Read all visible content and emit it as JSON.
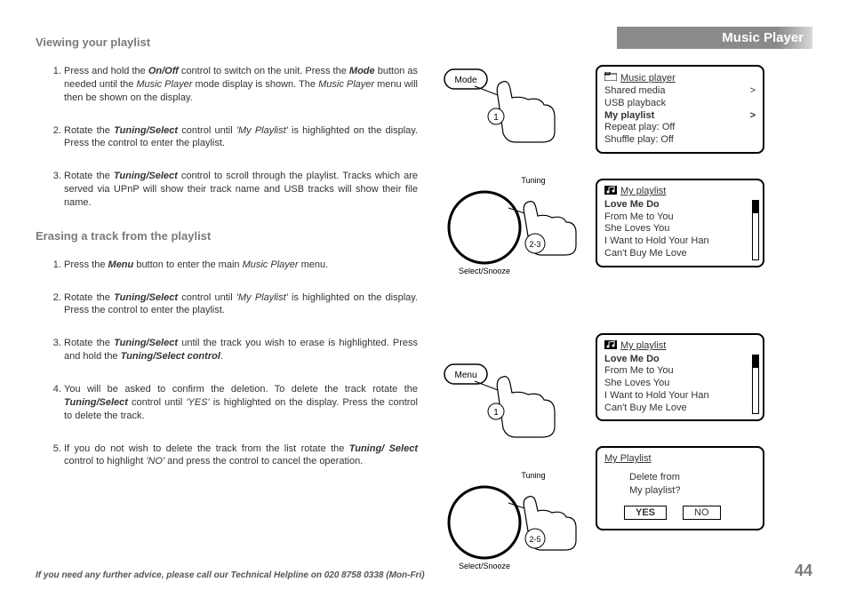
{
  "header": {
    "section_title_1": "Viewing your playlist",
    "music_bar": "Music Player",
    "section_title_2": "Erasing a track from the playlist"
  },
  "viewing_steps": [
    {
      "pre": "Press and hold the ",
      "b1": "On/Off",
      "mid1": " control to switch on the unit. Press the ",
      "b2": "Mode",
      "mid2": " button as needed until the ",
      "i1": "Music Player",
      "mid3": " mode display is shown. The ",
      "i2": "Music Player",
      "post": " menu will then be shown on the display."
    },
    {
      "pre": "Rotate the ",
      "b1": "Tuning/Select",
      "mid1": " control until ",
      "i1": "'My Playlist'",
      "post": " is highlighted on the display. Press the control to enter the playlist."
    },
    {
      "pre": "Rotate the ",
      "b1": "Tuning/Select",
      "post": " control to scroll through the playlist. Tracks which are served via UPnP will show their track name and USB tracks will show their file name."
    }
  ],
  "erasing_steps": [
    {
      "pre": "Press the ",
      "b1": "Menu",
      "mid1": " button to enter the main ",
      "i1": "Music Player",
      "post": " menu."
    },
    {
      "pre": "Rotate the ",
      "b1": "Tuning/Select",
      "mid1": " control until ",
      "i1": "'My Playlist'",
      "post": " is highlighted on the display. Press the control to enter the playlist."
    },
    {
      "pre": "Rotate the ",
      "b1": "Tuning/Select",
      "mid1": " until the track you wish to erase is highlighted. Press and hold the ",
      "b2": "Tuning/Select control",
      "post": "."
    },
    {
      "pre": "You will be asked to confirm the deletion. To delete the track rotate the ",
      "b1": "Tuning/Select",
      "mid1": " control until ",
      "i1": "'YES'",
      "post": " is highlighted on the display. Press the control to delete the track."
    },
    {
      "pre": "If you do not wish to delete the track from the list rotate the ",
      "b1": "Tuning/ Select",
      "mid1": " control to highlight ",
      "i1": "'NO'",
      "post": " and press the control to cancel the operation."
    }
  ],
  "illus": {
    "mode_label": "Mode",
    "mode_step": "1",
    "dial_top": "Tuning",
    "dial_bottom": "Select/Snooze",
    "dial_step_a": "2-3",
    "menu_label": "Menu",
    "menu_step": "1",
    "dial_step_b": "2-5"
  },
  "screens": {
    "s1": {
      "title": "Music player",
      "rows": [
        {
          "t": "Shared media",
          "r": ">"
        },
        {
          "t": "USB playback",
          "r": ""
        },
        {
          "t": "My playlist",
          "r": ">",
          "bold": true
        },
        {
          "t": "Repeat play: Off",
          "r": ""
        },
        {
          "t": "Shuffle play: Off",
          "r": ""
        }
      ]
    },
    "s2": {
      "title": "My playlist",
      "rows": [
        "Love Me Do",
        "From Me to You",
        "She Loves You",
        "I Want to Hold Your Han",
        "Can't Buy Me Love"
      ],
      "bold_row": 0
    },
    "s3": {
      "title": "My playlist",
      "rows": [
        "Love Me Do",
        "From Me to You",
        "She Loves You",
        "I Want to Hold Your Han",
        "Can't Buy Me Love"
      ],
      "bold_row": 0
    },
    "s4": {
      "title": "My Playlist",
      "question_l1": "Delete from",
      "question_l2": "My playlist?",
      "yes": "YES",
      "no": "NO"
    }
  },
  "footer": {
    "advice": "If you need any further advice, please call our Technical Helpline on 020 8758 0338 (Mon-Fri)",
    "page": "44"
  }
}
